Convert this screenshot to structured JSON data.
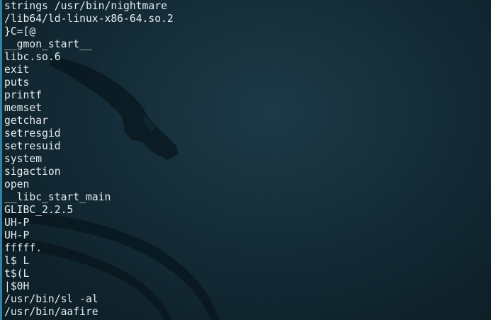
{
  "terminal": {
    "colors": {
      "background": "#142c37",
      "text": "#e6ecef",
      "left_border": "#2e83a8"
    },
    "wallpaper": "kali-dragon",
    "lines": [
      "strings /usr/bin/nightmare",
      "/lib64/ld-linux-x86-64.so.2",
      "}C=[@",
      "__gmon_start__",
      "libc.so.6",
      "exit",
      "puts",
      "printf",
      "memset",
      "getchar",
      "setresgid",
      "setresuid",
      "system",
      "sigaction",
      "open",
      "__libc_start_main",
      "GLIBC_2.2.5",
      "UH-P",
      "UH-P",
      "fffff.",
      "l$ L",
      "t$(L",
      "|$0H",
      "/usr/bin/sl -al",
      "/usr/bin/aafire"
    ]
  }
}
